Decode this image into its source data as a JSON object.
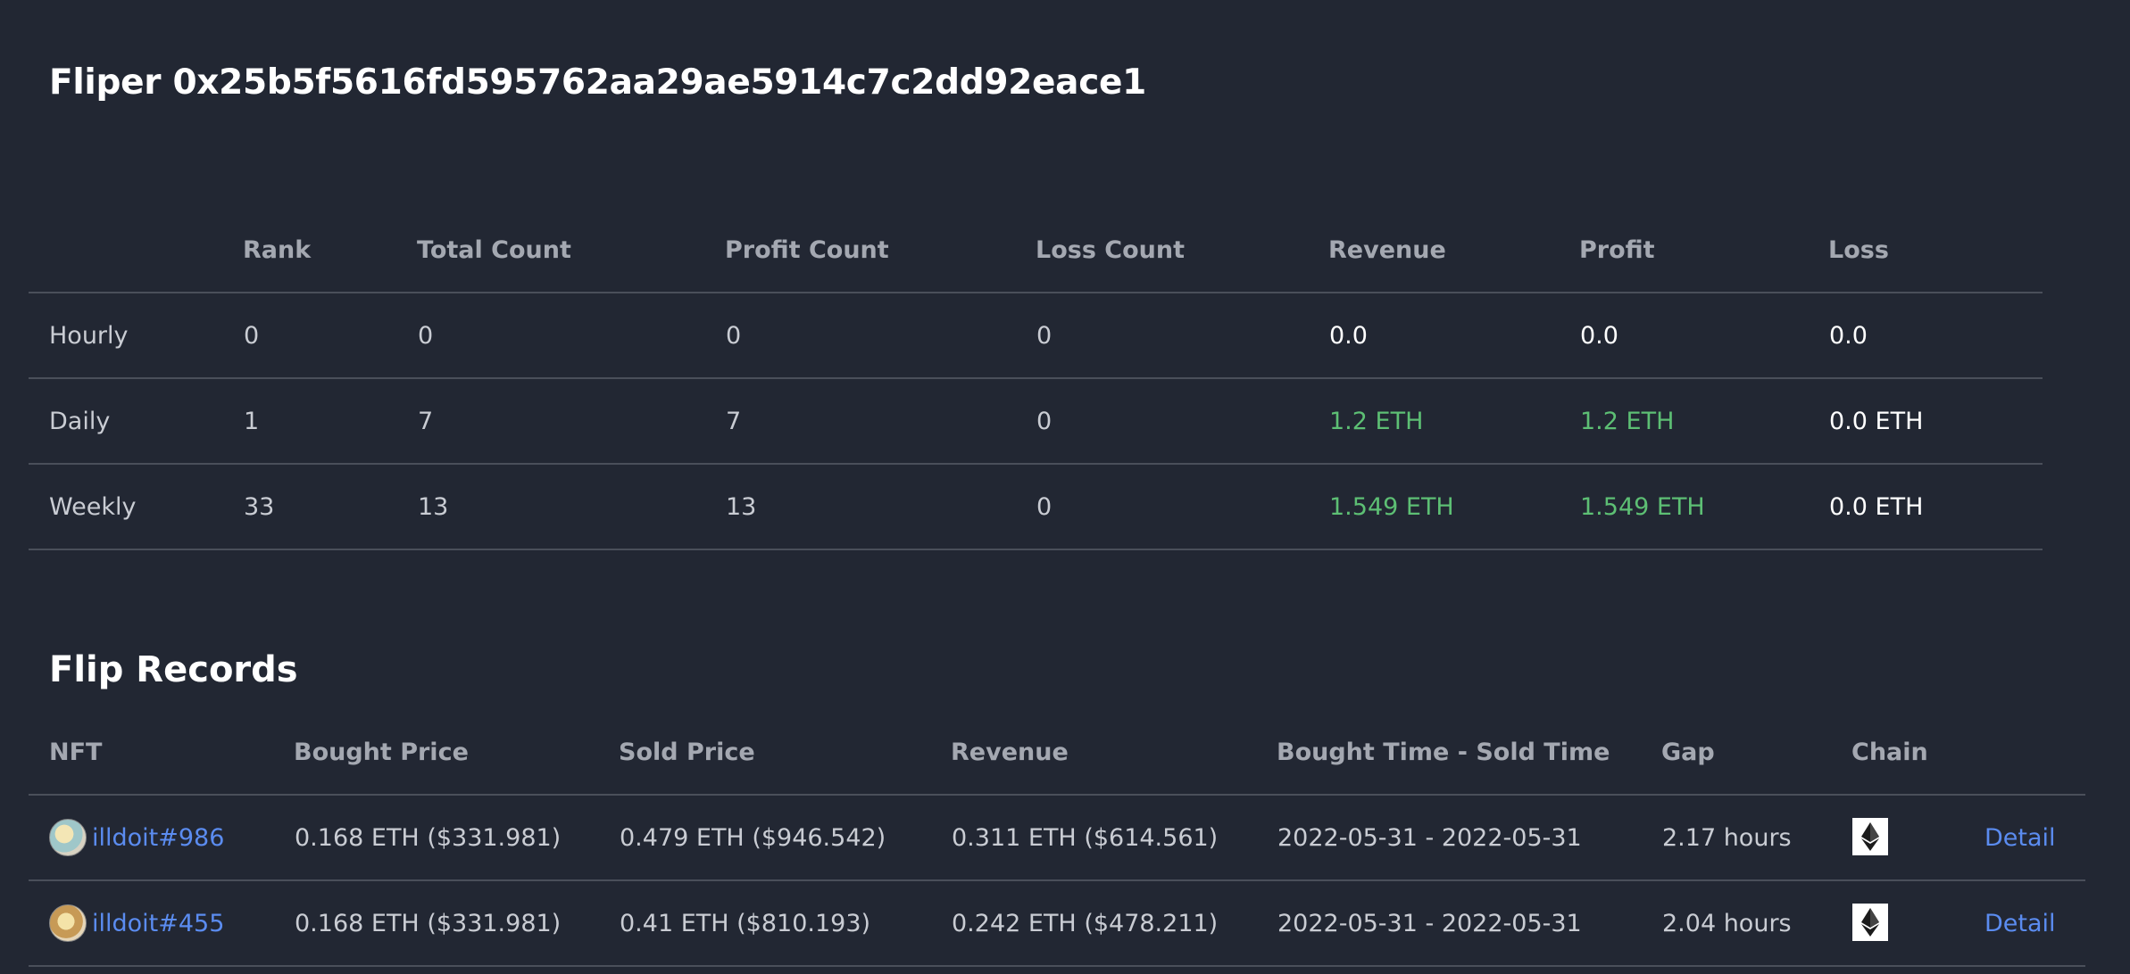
{
  "header": {
    "title": "Fliper 0x25b5f5616fd595762aa29ae5914c7c2dd92eace1"
  },
  "stats": {
    "columns": [
      "",
      "Rank",
      "Total Count",
      "Profit Count",
      "Loss Count",
      "Revenue",
      "Profit",
      "Loss"
    ],
    "rows": [
      {
        "period": "Hourly",
        "rank": "0",
        "total": "0",
        "profit_count": "0",
        "loss_count": "0",
        "revenue": "0.0",
        "profit": "0.0",
        "loss": "0.0"
      },
      {
        "period": "Daily",
        "rank": "1",
        "total": "7",
        "profit_count": "7",
        "loss_count": "0",
        "revenue": "1.2 ETH",
        "profit": "1.2 ETH",
        "loss": "0.0 ETH"
      },
      {
        "period": "Weekly",
        "rank": "33",
        "total": "13",
        "profit_count": "13",
        "loss_count": "0",
        "revenue": "1.549 ETH",
        "profit": "1.549 ETH",
        "loss": "0.0 ETH"
      }
    ]
  },
  "records": {
    "title": "Flip Records",
    "columns": [
      "NFT",
      "Bought Price",
      "Sold Price",
      "Revenue",
      "Bought Time - Sold Time",
      "Gap",
      "Chain",
      ""
    ],
    "rows": [
      {
        "nft": "illdoit#986",
        "bought": "0.168 ETH ($331.981)",
        "sold": "0.479 ETH ($946.542)",
        "revenue": "0.311 ETH ($614.561)",
        "time": "2022-05-31 - 2022-05-31",
        "gap": "2.17 hours",
        "chain_icon": "ethereum-icon",
        "action": "Detail"
      },
      {
        "nft": "illdoit#455",
        "bought": "0.168 ETH ($331.981)",
        "sold": "0.41 ETH ($810.193)",
        "revenue": "0.242 ETH ($478.211)",
        "time": "2022-05-31 - 2022-05-31",
        "gap": "2.04 hours",
        "chain_icon": "ethereum-icon",
        "action": "Detail"
      }
    ]
  },
  "colors": {
    "background": "#222733",
    "positive": "#5dbf74",
    "link": "#5b8cf0",
    "heading": "#ffffff"
  }
}
